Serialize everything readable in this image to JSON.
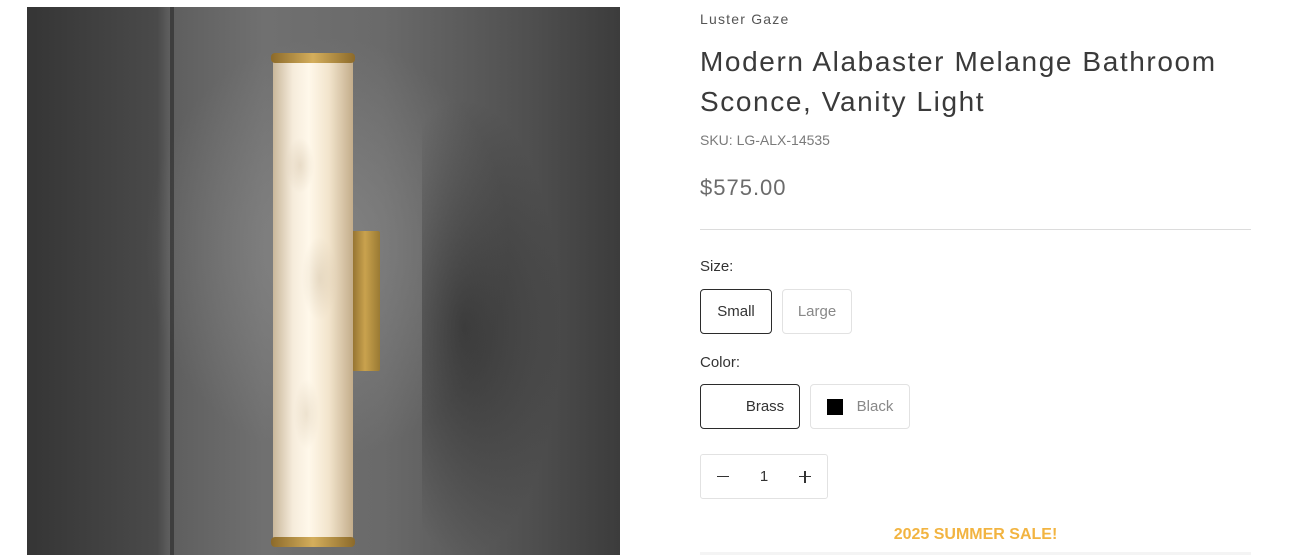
{
  "product": {
    "brand": "Luster Gaze",
    "title": "Modern Alabaster Melange Bathroom Sconce, Vanity Light",
    "sku": "SKU: LG-ALX-14535",
    "price": "$575.00"
  },
  "options": {
    "size": {
      "label": "Size:",
      "choices": [
        "Small",
        "Large"
      ],
      "selected": "Small"
    },
    "color": {
      "label": "Color:",
      "choices": [
        "Brass",
        "Black"
      ],
      "selected": "Brass",
      "swatches": {
        "Brass": "#ffffff",
        "Black": "#000000"
      }
    }
  },
  "quantity": {
    "value": "1",
    "decrease_icon": "minus-icon",
    "increase_icon": "plus-icon"
  },
  "promo": {
    "text": "2025 SUMMER SALE!",
    "color": "#f2b441"
  },
  "colors": {
    "accent": "#f2b441",
    "text": "#333333",
    "border": "#e2e2e2",
    "selected_border": "#2b2b2b"
  }
}
